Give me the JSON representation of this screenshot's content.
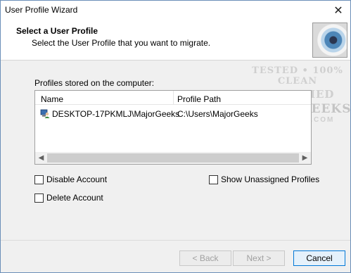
{
  "window": {
    "title": "User Profile Wizard",
    "close_glyph": "✕"
  },
  "header": {
    "title": "Select a User Profile",
    "subtitle": "Select the User Profile that you want to migrate.",
    "image_icon": "eye-icon"
  },
  "watermark": {
    "line1": "TESTED • 100% CLEAN",
    "line2": "CERTIFIED",
    "line3": "MAJORGEEKS",
    "line4": "★★★★★★ .COM"
  },
  "profiles": {
    "label": "Profiles stored on the computer:",
    "columns": {
      "name": "Name",
      "path": "Profile Path"
    },
    "rows": [
      {
        "name": "DESKTOP-17PKMLJ\\MajorGeeks",
        "path": "C:\\Users\\MajorGeeks",
        "icon": "user-profile-icon"
      }
    ]
  },
  "options": {
    "disable_account": "Disable Account",
    "delete_account": "Delete Account",
    "show_unassigned": "Show Unassigned Profiles"
  },
  "buttons": {
    "back": "< Back",
    "next": "Next >",
    "cancel": "Cancel"
  }
}
